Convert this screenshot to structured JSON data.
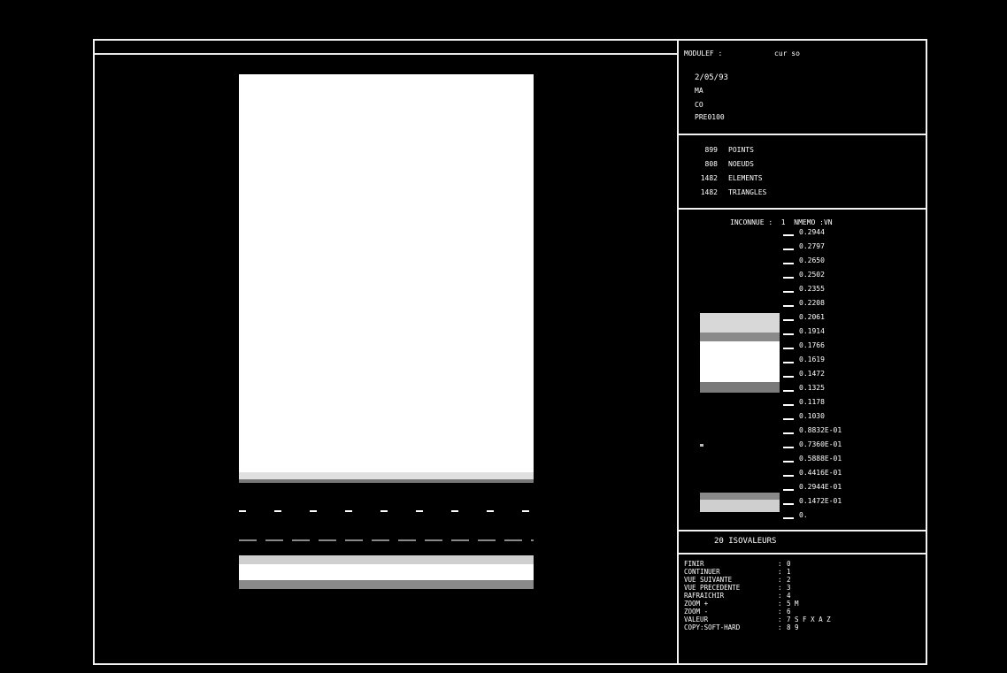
{
  "header": {
    "program": "MODULEF :",
    "case": "cur so",
    "date": "2/05/93",
    "line1": "MA",
    "line2": "CO",
    "line3": "PRE0100"
  },
  "stats": [
    {
      "count": "899",
      "label": "POINTS"
    },
    {
      "count": "808",
      "label": "NOEUDS"
    },
    {
      "count": "1482",
      "label": "ELEMENTS"
    },
    {
      "count": "1482",
      "label": "TRIANGLES"
    }
  ],
  "legend": {
    "title": "INCONNUE :  1  NMEMO :VN",
    "values": [
      "0.2944",
      "0.2797",
      "0.2650",
      "0.2502",
      "0.2355",
      "0.2208",
      "0.2061",
      "0.1914",
      "0.1766",
      "0.1619",
      "0.1472",
      "0.1325",
      "0.1178",
      "0.1030",
      "0.8832E-01",
      "0.7360E-01",
      "0.5888E-01",
      "0.4416E-01",
      "0.2944E-01",
      "0.1472E-01",
      "0."
    ]
  },
  "isovalues": "20 ISOVALEURS",
  "menu": [
    {
      "label": "FINIR",
      "sep": ":",
      "keys": "0"
    },
    {
      "label": "CONTINUER",
      "sep": ":",
      "keys": "1"
    },
    {
      "label": "VUE SUIVANTE",
      "sep": ":",
      "keys": "2"
    },
    {
      "label": "VUE PRECEDENTE",
      "sep": ":",
      "keys": "3"
    },
    {
      "label": "RAFRAICHIR",
      "sep": ":",
      "keys": "4"
    },
    {
      "label": "ZOOM +",
      "sep": ":",
      "keys": "5 M"
    },
    {
      "label": "ZOOM -",
      "sep": ":",
      "keys": "6"
    },
    {
      "label": "VALEUR",
      "sep": ":",
      "keys": "7 S F X A Z"
    },
    {
      "label": "COPY:SOFT-HARD",
      "sep": ":",
      "keys": "8 9"
    }
  ],
  "colors": {
    "background": "#000000",
    "foreground": "#ffffff"
  }
}
